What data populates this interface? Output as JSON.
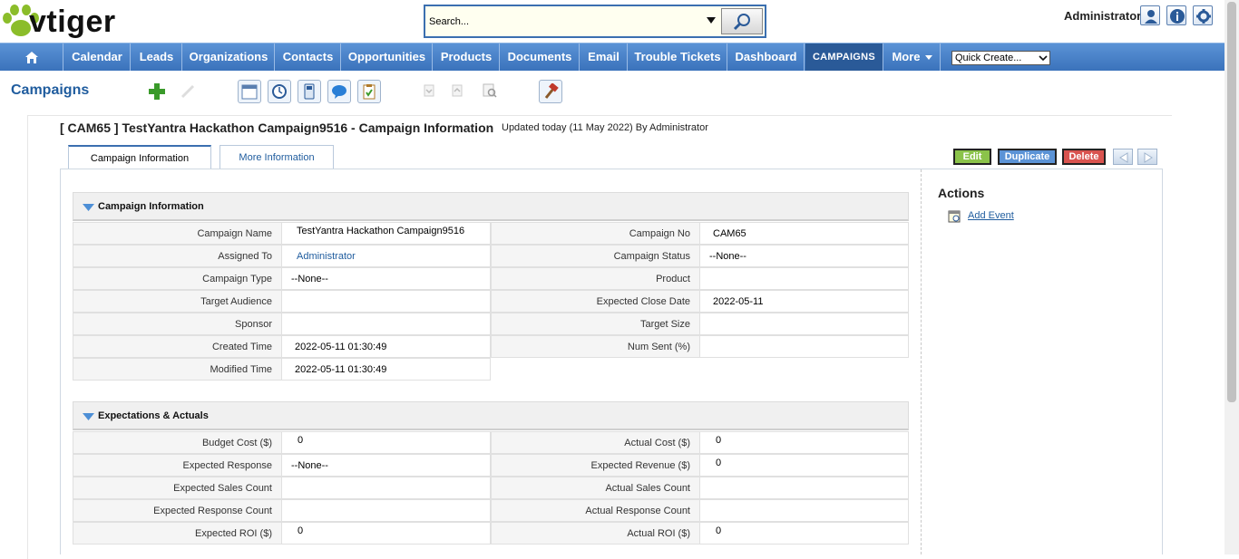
{
  "header": {
    "logo_text": "vtiger",
    "search_placeholder": "Search...",
    "user_name": "Administrator"
  },
  "nav": {
    "items": [
      {
        "label": "Calendar"
      },
      {
        "label": "Leads"
      },
      {
        "label": "Organizations"
      },
      {
        "label": "Contacts"
      },
      {
        "label": "Opportunities"
      },
      {
        "label": "Products"
      },
      {
        "label": "Documents"
      },
      {
        "label": "Email"
      },
      {
        "label": "Trouble Tickets"
      },
      {
        "label": "Dashboard"
      },
      {
        "label": "CAMPAIGNS",
        "active": true
      },
      {
        "label": "More"
      }
    ],
    "quick_create": "Quick Create..."
  },
  "module": {
    "title": "Campaigns"
  },
  "record": {
    "title": "[ CAM65 ] TestYantra Hackathon Campaign9516 - Campaign Information",
    "updated": "Updated today (11 May 2022) By Administrator"
  },
  "tabs": [
    {
      "label": "Campaign Information",
      "active": true
    },
    {
      "label": "More Information",
      "active": false
    }
  ],
  "buttons": {
    "edit": "Edit",
    "duplicate": "Duplicate",
    "delete": "Delete"
  },
  "colors": {
    "brand_blue": "#3a72bb",
    "edit_green": "#8bc34a",
    "duplicate_blue": "#5b93d6",
    "delete_red": "#d9534f",
    "link_blue": "#1f5c9e"
  },
  "section1": {
    "title": "Campaign Information",
    "left": [
      {
        "label": "Campaign Name",
        "value": "TestYantra Hackathon Campaign9516"
      },
      {
        "label": "Assigned To",
        "value": "Administrator"
      },
      {
        "label": "Campaign Type",
        "value": "--None--"
      },
      {
        "label": "Target Audience",
        "value": ""
      },
      {
        "label": "Sponsor",
        "value": ""
      },
      {
        "label": "Created Time",
        "value": "2022-05-11 01:30:49"
      },
      {
        "label": "Modified Time",
        "value": "2022-05-11 01:30:49"
      }
    ],
    "right": [
      {
        "label": "Campaign No",
        "value": "CAM65"
      },
      {
        "label": "Campaign Status",
        "value": "--None--"
      },
      {
        "label": "Product",
        "value": ""
      },
      {
        "label": "Expected Close Date",
        "value": "2022-05-11"
      },
      {
        "label": "Target Size",
        "value": ""
      },
      {
        "label": "Num Sent (%)",
        "value": ""
      }
    ]
  },
  "section2": {
    "title": "Expectations & Actuals",
    "left": [
      {
        "label": "Budget Cost ($)",
        "value": "0"
      },
      {
        "label": "Expected Response",
        "value": "--None--"
      },
      {
        "label": "Expected Sales Count",
        "value": ""
      },
      {
        "label": "Expected Response Count",
        "value": ""
      },
      {
        "label": "Expected ROI ($)",
        "value": "0"
      }
    ],
    "right": [
      {
        "label": "Actual Cost ($)",
        "value": "0"
      },
      {
        "label": "Expected Revenue ($)",
        "value": "0"
      },
      {
        "label": "Actual Sales Count",
        "value": ""
      },
      {
        "label": "Actual Response Count",
        "value": ""
      },
      {
        "label": "Actual ROI ($)",
        "value": "0"
      }
    ]
  },
  "actions": {
    "title": "Actions",
    "add_event": "Add Event"
  }
}
